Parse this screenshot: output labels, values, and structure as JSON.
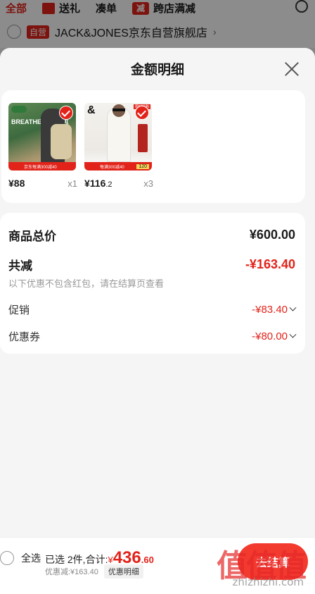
{
  "background": {
    "tabs": [
      "全部",
      "送礼",
      "凑单",
      "跨店满减"
    ],
    "store_badge": "自营",
    "store_name": "JACK&JONES京东自营旗舰店",
    "store_chevron": "›"
  },
  "sheet": {
    "title": "金额明细",
    "products": [
      {
        "price_main": "¥88",
        "price_decimal": "",
        "qty": "x1",
        "badge_text": "京东每满300减40",
        "image_text": "BREATHE 透气背包"
      },
      {
        "price_main": "¥116",
        "price_decimal": ".2",
        "qty": "x3",
        "badge_text": "每满300减40",
        "image_text": "&",
        "count_tag": "120",
        "top_tag": "限时抢购"
      }
    ],
    "summary": {
      "total_label": "商品总价",
      "total_value": "¥600.00",
      "reduce_label": "共减",
      "reduce_value": "-¥163.40",
      "note": "以下优惠不包含红包，请在结算页查看",
      "promo_label": "促销",
      "promo_value": "-¥83.40",
      "coupon_label": "优惠券",
      "coupon_value": "-¥80.00"
    }
  },
  "bottom_bar": {
    "select_all": "全选",
    "picked_prefix": "已选 2件,合计:",
    "currency": "¥",
    "total_int": "436",
    "total_dec": ".60",
    "discount_text": "优惠减:¥163.40",
    "detail_btn": "优惠明细",
    "checkout": "去结算"
  },
  "watermark": {
    "logo": "值值值",
    "url": "zhizhizhi.com"
  },
  "colors": {
    "accent": "#e2231a",
    "checkout": "#f33a2f"
  }
}
